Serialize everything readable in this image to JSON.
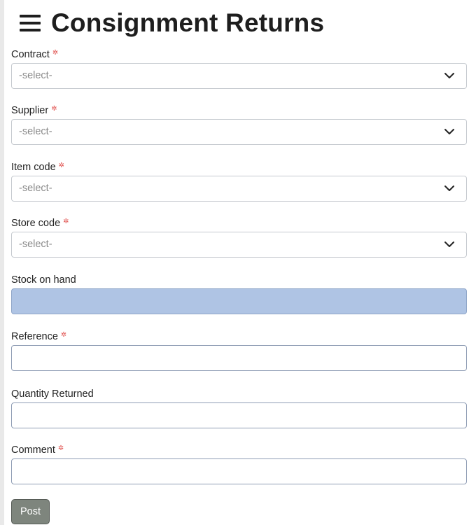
{
  "header": {
    "title": "Consignment Returns",
    "menu_icon": "hamburger-menu-icon"
  },
  "form": {
    "contract": {
      "label": "Contract",
      "required_mark": "✲",
      "value": "-select-"
    },
    "supplier": {
      "label": "Supplier",
      "required_mark": "✲",
      "value": "-select-"
    },
    "item_code": {
      "label": "Item code",
      "required_mark": "✲",
      "value": "-select-"
    },
    "store_code": {
      "label": "Store code",
      "required_mark": "✲",
      "value": "-select-"
    },
    "stock_on_hand": {
      "label": "Stock on hand",
      "value": ""
    },
    "reference": {
      "label": "Reference",
      "required_mark": "✲",
      "value": ""
    },
    "quantity_returned": {
      "label": "Quantity Returned",
      "value": ""
    },
    "comment": {
      "label": "Comment",
      "required_mark": "✲",
      "value": ""
    }
  },
  "actions": {
    "post_label": "Post"
  },
  "colors": {
    "required": "#e0524f",
    "readonly_bg": "#afc4e4",
    "button_bg": "#7e857d"
  }
}
